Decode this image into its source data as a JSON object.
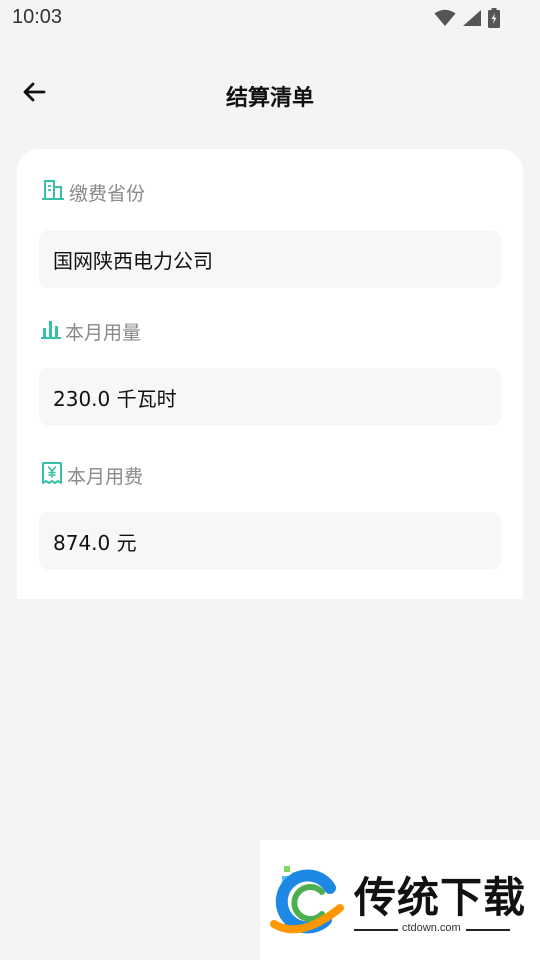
{
  "status_bar": {
    "time": "10:03",
    "icons": [
      "wifi-icon",
      "cellular-signal-icon",
      "battery-charging-icon"
    ]
  },
  "header": {
    "title": "结算清单",
    "back_icon": "arrow-left-icon"
  },
  "sections": [
    {
      "label": "缴费省份",
      "icon": "building-icon",
      "value": "国网陕西电力公司"
    },
    {
      "label": "本月用量",
      "icon": "bar-chart-icon",
      "value": "230.0 千瓦时"
    },
    {
      "label": "本月用费",
      "icon": "yuan-receipt-icon",
      "value": "874.0 元"
    }
  ],
  "watermark": {
    "brand_text": "传统下载",
    "url": "ctdown.com",
    "icon": "ctdown-logo-icon"
  },
  "colors": {
    "background": "#f4f4f4",
    "card": "#ffffff",
    "value_box": "#f7f7f7",
    "accent": "#36c2a6",
    "label_text": "#8a8a8a"
  }
}
